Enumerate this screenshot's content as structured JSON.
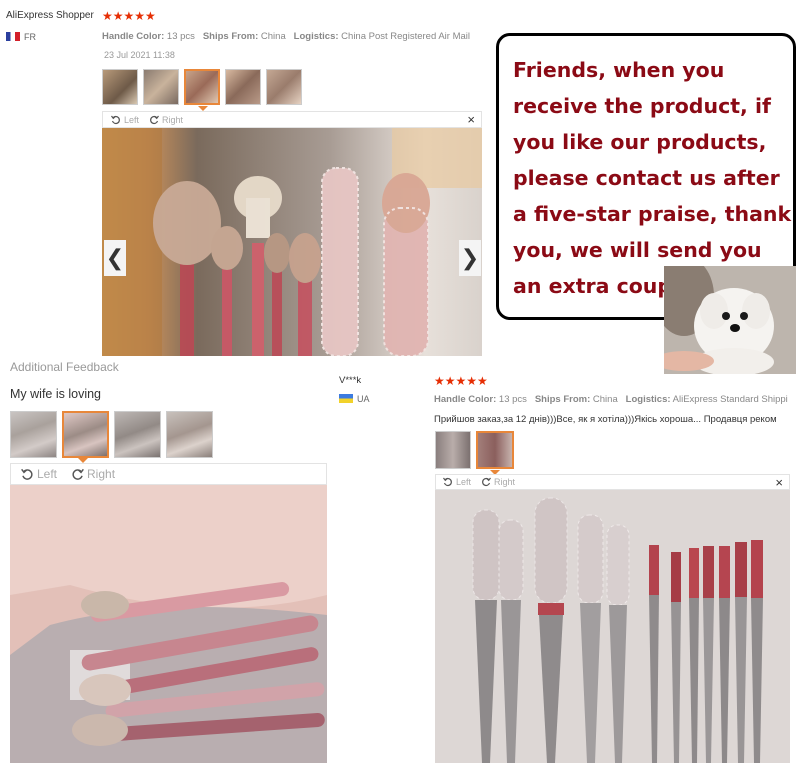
{
  "review1": {
    "user": "AliExpress Shopper",
    "stars": "★★★★★",
    "country": "FR",
    "handle_color_label": "Handle Color:",
    "handle_color_value": "13 pcs",
    "ships_from_label": "Ships From:",
    "ships_from_value": "China",
    "logistics_label": "Logistics:",
    "logistics_value": "China Post Registered Air Mail",
    "date": "23 Jul 2021 11:38",
    "rotate_left": "Left",
    "rotate_right": "Right",
    "close": "×",
    "prev": "❮",
    "next": "❯"
  },
  "promo": {
    "text": "Friends, when you receive the product, if you like our products, please contact us after a five-star praise, thank you, we will send you an extra coupon"
  },
  "additional": {
    "title": "Additional Feedback",
    "text": "My wife is loving",
    "rotate_left": "Left",
    "rotate_right": "Right"
  },
  "review2": {
    "user": "V***k",
    "country": "UA",
    "stars": "★★★★★",
    "handle_color_label": "Handle Color:",
    "handle_color_value": "13 pcs",
    "ships_from_label": "Ships From:",
    "ships_from_value": "China",
    "logistics_label": "Logistics:",
    "logistics_value": "AliExpress Standard Shippi",
    "text": "Прийшов заказ,за 12 днів)))Все, як я хотіла)))Якісь хороша... Продавця реком",
    "rotate_left": "Left",
    "rotate_right": "Right",
    "close": "×"
  },
  "colors": {
    "star": "#e62e04",
    "promo_text": "#8b0a15",
    "active_thumb": "#e8873a"
  }
}
